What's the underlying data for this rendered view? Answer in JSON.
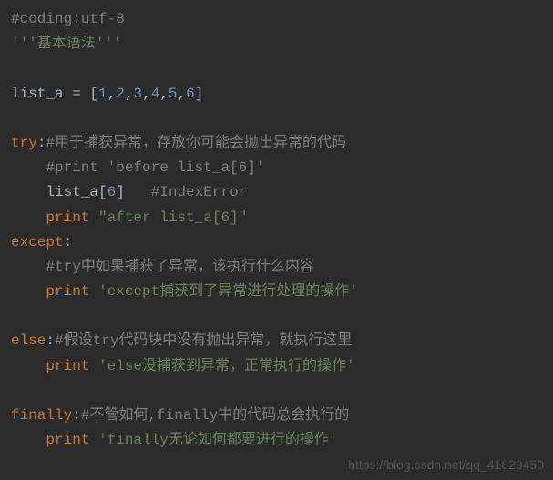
{
  "lines": {
    "l1_comment": "#coding:utf-8",
    "l2_docstr": "'''基本语法'''",
    "l4_var": "list_a",
    "l4_eq": " = ",
    "l4_lb": "[",
    "l4_n1": "1",
    "l4_c": ",",
    "l4_n2": "2",
    "l4_n3": "3",
    "l4_n4": "4",
    "l4_n5": "5",
    "l4_n6": "6",
    "l4_rb": "]",
    "l6_try": "try",
    "l6_colon": ":",
    "l6_comment": "#用于捕获异常，存放你可能会抛出异常的代码",
    "l7_comment": "#print 'before list_a[6]'",
    "l8_var": "list_a",
    "l8_lb": "[",
    "l8_idx": "6",
    "l8_rb": "]",
    "l8_comment": "   #IndexError",
    "l9_print": "print",
    "l9_str": " \"after list_a[6]\"",
    "l10_except": "except",
    "l10_colon": ":",
    "l11_comment": "#try中如果捕获了异常，该执行什么内容",
    "l12_print": "print",
    "l12_str": " 'except捕获到了异常进行处理的操作'",
    "l14_else": "else",
    "l14_colon": ":",
    "l14_comment": "#假设try代码块中没有抛出异常，就执行这里",
    "l15_print": "print",
    "l15_str": " 'else没捕获到异常，正常执行的操作'",
    "l17_finally": "finally",
    "l17_colon": ":",
    "l17_comment": "#不管如何,finally中的代码总会执行的",
    "l18_print": "print",
    "l18_str": " 'finally无论如何都要进行的操作'"
  },
  "watermark": "https://blog.csdn.net/qq_41829450"
}
